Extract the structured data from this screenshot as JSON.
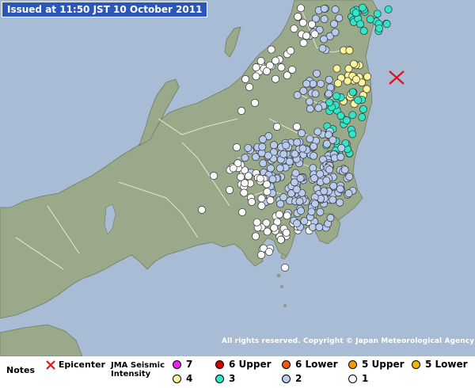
{
  "header": {
    "issued": "Issued at 11:50 JST  10 October 2011"
  },
  "copyright": "All rights reserved. Copyright © Japan Meteorological Agency",
  "legend": {
    "notes_label": "Notes",
    "epicenter_label": "Epicenter",
    "epicenter_color": "#e0101a",
    "intensity_title": "JMA Seismic Intensity",
    "items": [
      {
        "label": "7",
        "color": "#f020f0"
      },
      {
        "label": "6 Upper",
        "color": "#d40000"
      },
      {
        "label": "6 Lower",
        "color": "#f05a00"
      },
      {
        "label": "5 Upper",
        "color": "#f59a00"
      },
      {
        "label": "5 Lower",
        "color": "#f2b800"
      },
      {
        "label": "4",
        "color": "#fff59a"
      },
      {
        "label": "3",
        "color": "#2ee6c8"
      },
      {
        "label": "2",
        "color": "#b8ccf0"
      },
      {
        "label": "1",
        "color": "#ffffff"
      }
    ]
  },
  "colors": {
    "sea": "#a9bcd6",
    "land": "#9aa98a",
    "border": "#ffffff"
  }
}
